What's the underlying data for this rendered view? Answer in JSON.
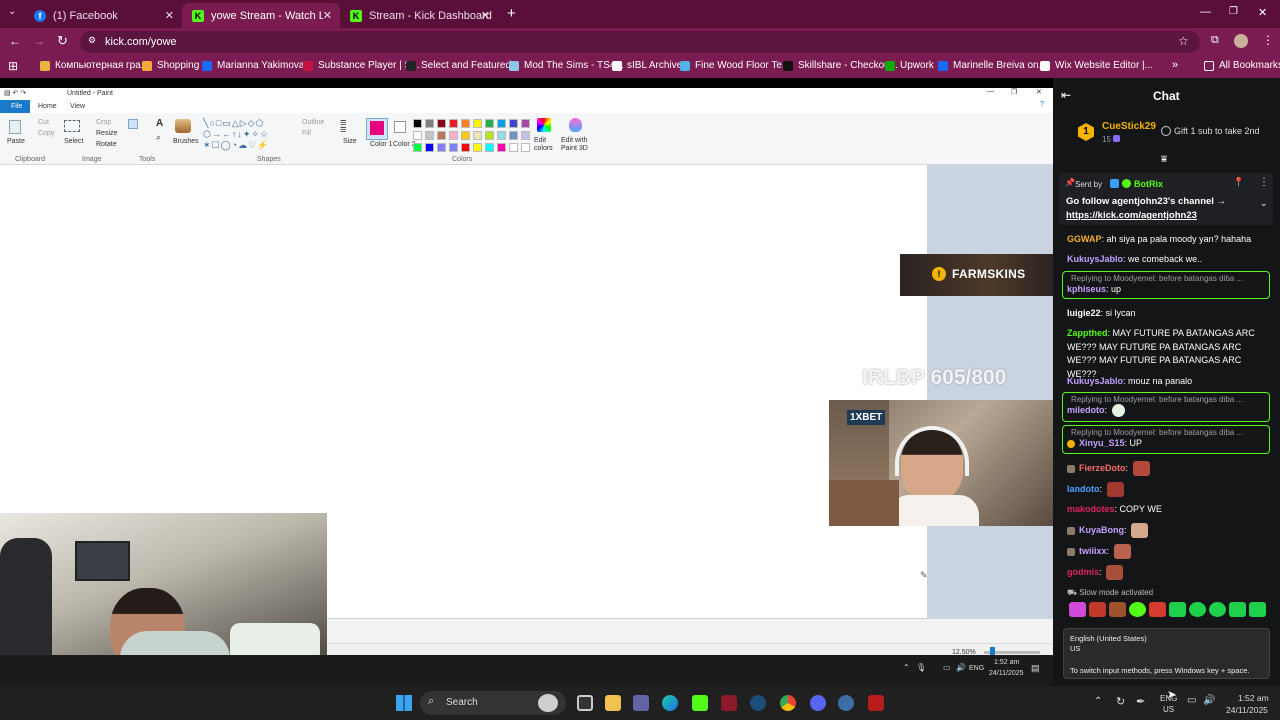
{
  "browser": {
    "tabs": [
      {
        "title": "(1) Facebook",
        "color": "#1877f2",
        "glyph": "f"
      },
      {
        "title": "yowe Stream - Watch Live on K",
        "color": "#53fc18",
        "glyph": "K"
      },
      {
        "title": "Stream - Kick Dashboard",
        "color": "#53fc18",
        "glyph": "K"
      }
    ],
    "new_tab": "+",
    "url": "kick.com/yowe",
    "bookmarks": [
      {
        "label": "Компьютерная гра...",
        "color": "#e7b341"
      },
      {
        "label": "Shopping",
        "color": "#f4a93b"
      },
      {
        "label": "Marianna Yakimova...",
        "color": "#1769ff"
      },
      {
        "label": "Substance Player | S...",
        "color": "#c2133c"
      },
      {
        "label": "Select and Featured...",
        "color": "#222222"
      },
      {
        "label": "Mod The Sims - TS4...",
        "color": "#8ec6e8"
      },
      {
        "label": "sIBL Archive",
        "color": "#ffffff"
      },
      {
        "label": "Fine Wood Floor Te...",
        "color": "#4fb3e6"
      },
      {
        "label": "Skillshare - Checkou...",
        "color": "#111111"
      },
      {
        "label": "Upwork",
        "color": "#14a800"
      },
      {
        "label": "Marinelle Breiva on...",
        "color": "#1769ff"
      },
      {
        "label": "Wix Website Editor |...",
        "color": "#ffffff"
      }
    ],
    "all_bookmarks": "All Bookmarks",
    "more": "»"
  },
  "paint": {
    "title": "Untitled - Paint",
    "menu": [
      "File",
      "Home",
      "View"
    ],
    "clipboard": {
      "paste": "Paste",
      "cut": "Cut",
      "copy": "Copy",
      "group": "Clipboard"
    },
    "image": {
      "select": "Select",
      "crop": "Crop",
      "resize": "Resize",
      "rotate": "Rotate",
      "group": "Image"
    },
    "tools": {
      "group": "Tools",
      "brushes": "Brushes"
    },
    "shapes": {
      "outline": "Outline",
      "fill": "Fill",
      "group": "Shapes",
      "size": "Size"
    },
    "colors": {
      "color1": "Color 1",
      "color2": "Color 2",
      "group": "Colors",
      "edit": "Edit colors",
      "paint3d": "Edit with Paint 3D"
    },
    "palette": [
      "#000000",
      "#7f7f7f",
      "#880015",
      "#ed1c24",
      "#ff7f27",
      "#fff200",
      "#22b14c",
      "#00a2e8",
      "#3f48cc",
      "#a349a4",
      "#ffffff",
      "#c3c3c3",
      "#b97a57",
      "#ffaec9",
      "#ffc90e",
      "#efe4b0",
      "#b5e61d",
      "#99d9ea",
      "#7092be",
      "#c8bfe7",
      "#00ff40",
      "#0000ff",
      "#7f7fff",
      "#8080ff",
      "#ff0000",
      "#ffff00",
      "#00ffff",
      "#ff00aa",
      "#ffffff",
      "#ffffff"
    ],
    "zoom": "12.50%",
    "active_color": "#e6007e"
  },
  "overlay": {
    "farmskins": "FARMSKINS",
    "counter": "IRLBP 605/800",
    "cam_sponsor": "1XBET"
  },
  "inner_taskbar": {
    "lang": "ENG",
    "time": "1:52 am",
    "date": "24/11/2025"
  },
  "chat": {
    "header": "Chat",
    "top_gifter": {
      "rank": "1",
      "name": "CueStick29",
      "count": "15",
      "promo": "Gift 1 sub to take 2nd"
    },
    "pinned": {
      "sent_by": "Sent by",
      "bot": "BotRix",
      "text": "Go follow agentjohn23's channel →",
      "link": "https://kick.com/agentjohn23"
    },
    "messages": [
      {
        "user": "GGWAP",
        "color": "#f2b134",
        "text": "ah siya pa pala moody yan? hahaha"
      },
      {
        "user": "KukuysJablo",
        "color": "#c4a0ff",
        "text": "we comeback we.."
      },
      {
        "user": "kphiseus",
        "color": "#c4a0ff",
        "reply": "Replying to Moodyemel: before batangas diba ...",
        "text": "up"
      },
      {
        "user": "luigie22",
        "color": "#ffffff",
        "text": "si lycan"
      },
      {
        "user": "Zappthed",
        "color": "#53fc18",
        "text": "MAY FUTURE PA BATANGAS ARC WE??? MAY FUTURE PA BATANGAS ARC WE??? MAY FUTURE PA BATANGAS ARC WE???"
      },
      {
        "user": "KukuysJablo",
        "color": "#c4a0ff",
        "text": "mouz na panalo"
      },
      {
        "user": "miledoto",
        "color": "#c4a0ff",
        "reply": "Replying to Moodyemel: before batangas diba ...",
        "text": ""
      },
      {
        "user": "Xinyu_S15",
        "color": "#c4a0ff",
        "reply": "Replying to Moodyemel: before batangas diba ...",
        "text": "UP"
      },
      {
        "user": "FierzeDoto",
        "color": "#ff6b6b",
        "text": ""
      },
      {
        "user": "landoto",
        "color": "#4aa3ff",
        "text": ""
      },
      {
        "user": "makodotes",
        "color": "#e0245e",
        "text": "COPY WE"
      },
      {
        "user": "KuyaBong",
        "color": "#c4a0ff",
        "text": ""
      },
      {
        "user": "twiiixx",
        "color": "#c4a0ff",
        "text": ""
      },
      {
        "user": "godmis",
        "color": "#e0245e",
        "text": ""
      }
    ],
    "slow_mode": "Slow mode activated",
    "ime_popup": {
      "lang": "English (United States)",
      "region": "US",
      "hint": "To switch input methods, press Windows key + space."
    }
  },
  "taskbar": {
    "search": "Search",
    "lang": "ENG",
    "region": "US",
    "time": "1:52 am",
    "date": "24/11/2025"
  }
}
